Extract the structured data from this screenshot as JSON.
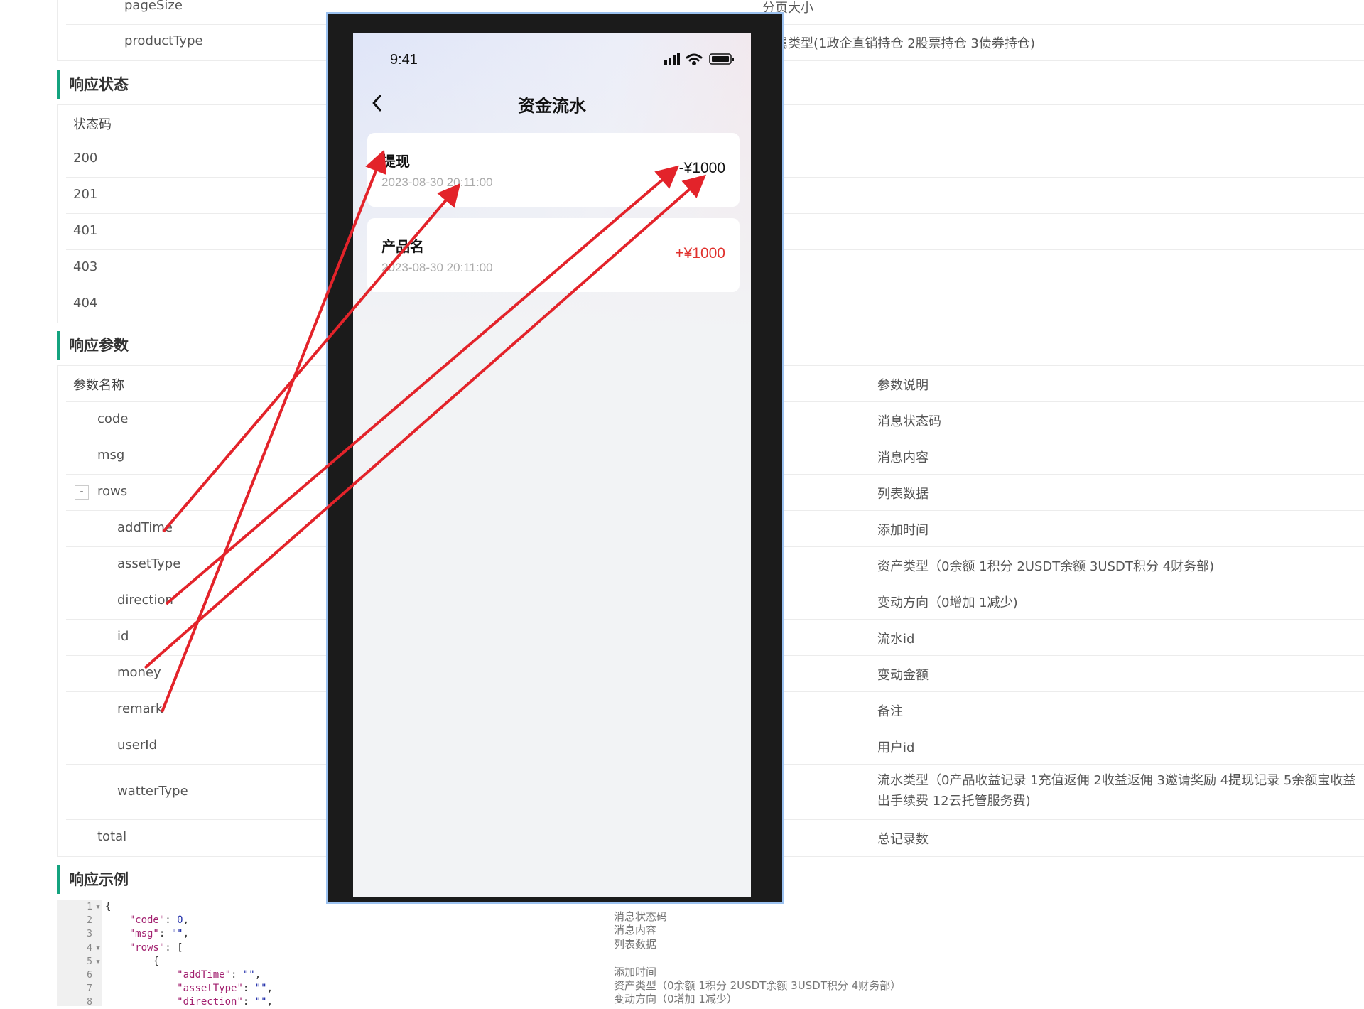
{
  "doc": {
    "request_rows": [
      {
        "name": "pageSize",
        "desc": "分页大小"
      },
      {
        "name": "productType",
        "desc": "所属类型(1政企直销持仓 2股票持仓 3债券持仓)"
      }
    ],
    "section_status": "响应状态",
    "status_rows": [
      "状态码",
      "200",
      "201",
      "401",
      "403",
      "404"
    ],
    "section_params": "响应参数",
    "params_header": {
      "name": "参数名称",
      "desc": "参数说明"
    },
    "params": [
      {
        "name": "code",
        "desc": "消息状态码"
      },
      {
        "name": "msg",
        "desc": "消息内容"
      },
      {
        "name": "rows",
        "desc": "列表数据",
        "toggle": "-"
      },
      {
        "name": "addTime",
        "desc": "添加时间"
      },
      {
        "name": "assetType",
        "desc": "资产类型（0余额 1积分 2USDT余额 3USDT积分 4财务部)"
      },
      {
        "name": "direction",
        "desc": "变动方向（0增加 1减少)"
      },
      {
        "name": "id",
        "desc": "流水id"
      },
      {
        "name": "money",
        "desc": "变动金额"
      },
      {
        "name": "remark",
        "desc": "备注"
      },
      {
        "name": "userId",
        "desc": "用户id"
      },
      {
        "name": "watterType",
        "desc": "流水类型（0产品收益记录 1充值返佣 2收益返佣 3邀请奖励 4提现记录 5余额宝收益",
        "desc2": "出手续费 12云托管服务费)"
      },
      {
        "name": "total",
        "desc": "总记录数"
      }
    ],
    "section_example": "响应示例",
    "code_lines": [
      {
        "n": "1",
        "fold": "▾",
        "text": "{"
      },
      {
        "n": "2",
        "key": "\"code\"",
        "val": "0",
        "tail": ","
      },
      {
        "n": "3",
        "key": "\"msg\"",
        "val": "\"\"",
        "tail": ","
      },
      {
        "n": "4",
        "fold": "▾",
        "key": "\"rows\"",
        "tail": ": ["
      },
      {
        "n": "5",
        "fold": "▾",
        "text": "{"
      },
      {
        "n": "6",
        "key": "\"addTime\"",
        "val": "\"\"",
        "tail": ","
      },
      {
        "n": "7",
        "key": "\"assetType\"",
        "val": "\"\"",
        "tail": ","
      },
      {
        "n": "8",
        "key": "\"direction\"",
        "val": "\"\"",
        "tail": ","
      }
    ],
    "code_comments": [
      "消息状态码",
      "消息内容",
      "列表数据",
      "",
      "添加时间",
      "资产类型（0余额 1积分 2USDT余额 3USDT积分 4财务部）",
      "变动方向（0增加 1减少）"
    ]
  },
  "phone": {
    "time": "9:41",
    "title": "资金流水",
    "cards": [
      {
        "title": "提现",
        "time": "2023-08-30 20:11:00",
        "amount": "-¥1000",
        "color": "#111111"
      },
      {
        "title": "产品名",
        "time": "2023-08-30 20:11:00",
        "amount": "+¥1000",
        "color": "#e0302c"
      }
    ]
  },
  "colors": {
    "accent": "#14a37f",
    "arrow": "#e3232a",
    "negative": "#e0302c"
  },
  "icons": {
    "back": "chevron-left-icon",
    "signal": "signal-icon",
    "wifi": "wifi-icon",
    "battery": "battery-icon"
  }
}
